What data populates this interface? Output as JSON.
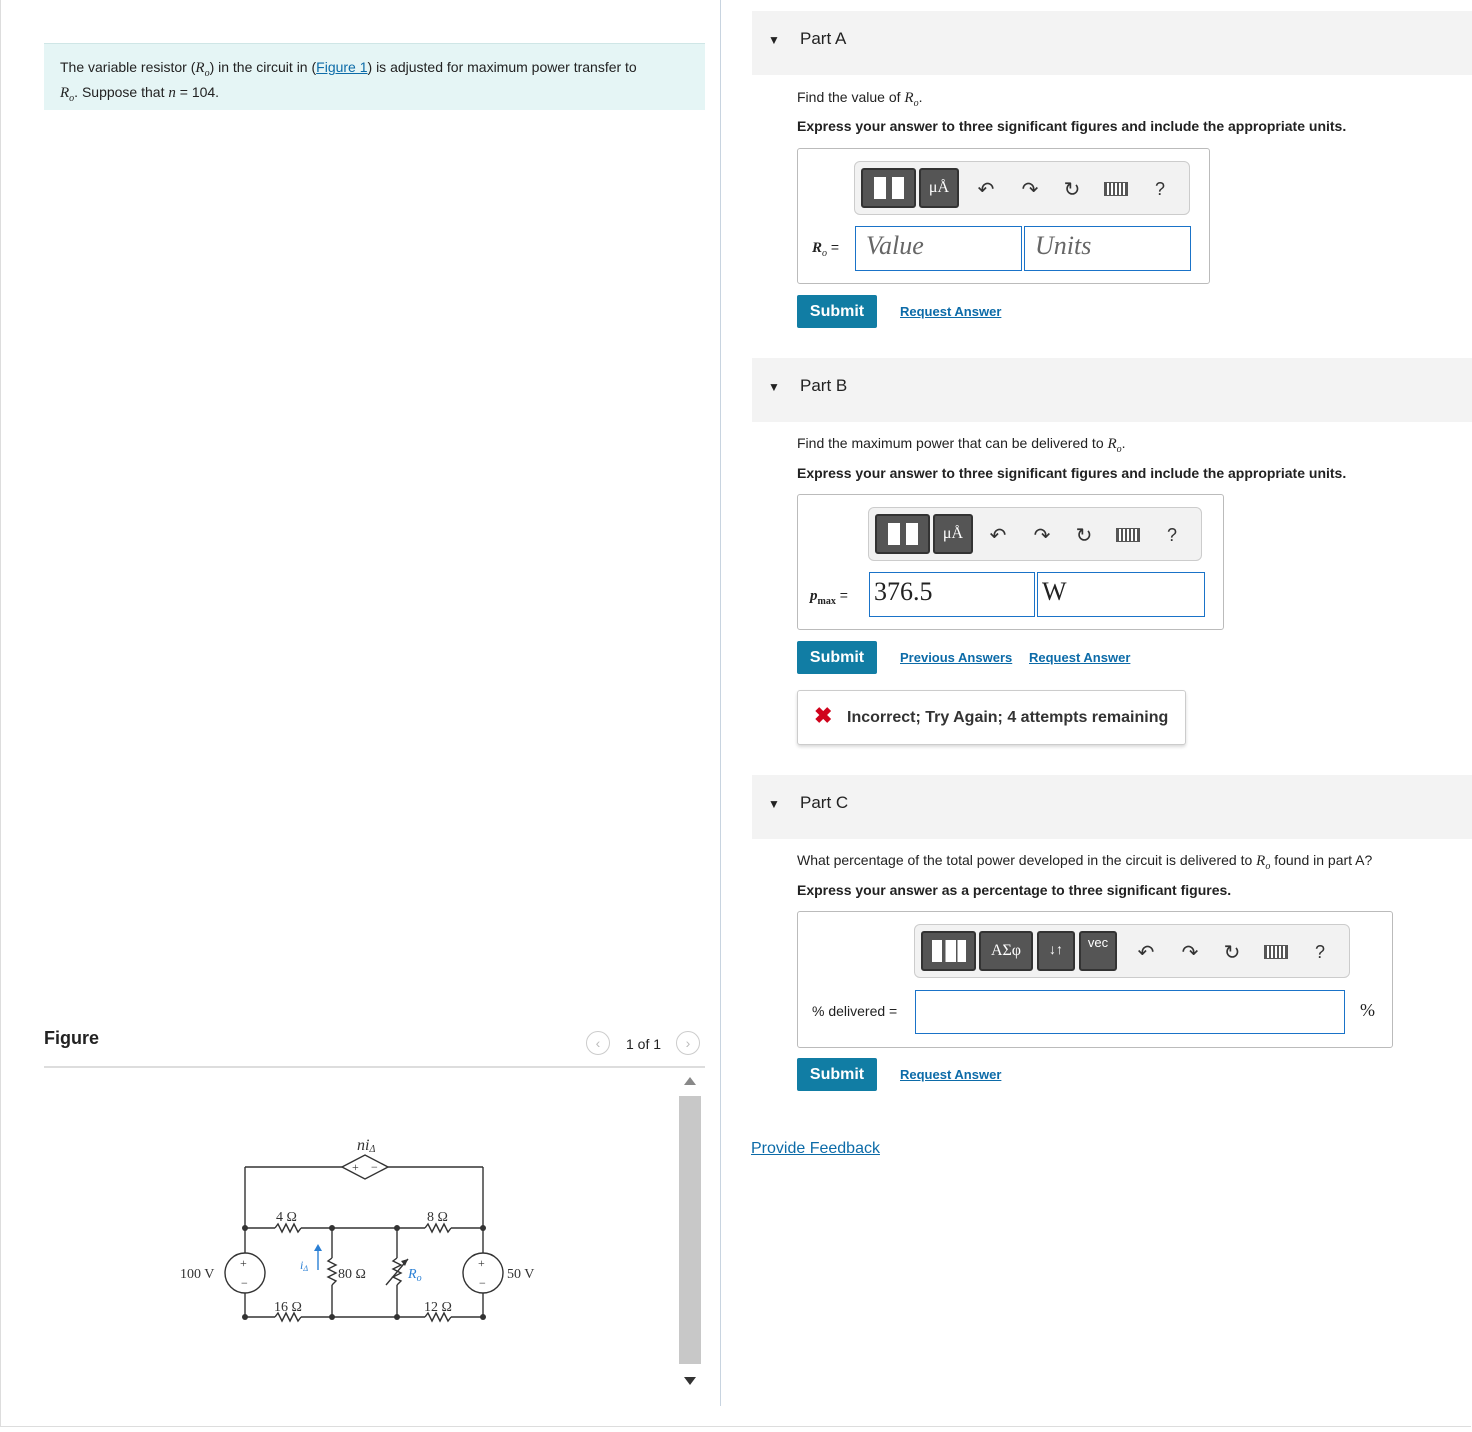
{
  "problem": {
    "text_before_link": "The variable resistor (",
    "r_symbol": "R",
    "r_sub": "o",
    "text_mid": ") in the circuit in (",
    "figure_link": "Figure 1",
    "text_after_link": ") is adjusted for maximum power transfer to",
    "line2_r": "R",
    "line2_r_sub": "o",
    "line2_text": ". Suppose that ",
    "n_symbol": "n",
    "n_value": " = 104."
  },
  "figure": {
    "title": "Figure",
    "pager": "1 of 1",
    "prev_icon": "‹",
    "next_icon": "›",
    "circuit": {
      "dep_source_label": "ni",
      "dep_source_sub": "Δ",
      "dep_plus": "+",
      "dep_minus": "−",
      "r4": "4 Ω",
      "r8": "8 Ω",
      "r80": "80 Ω",
      "ro": "R",
      "ro_sub": "o",
      "r16": "16 Ω",
      "r12": "12 Ω",
      "v100": "100 V",
      "v50": "50 V",
      "i_delta": "i",
      "i_delta_sub": "Δ"
    }
  },
  "partA": {
    "label": "Part A",
    "question": "Find the value of ",
    "question_sym": "R",
    "question_sub": "o",
    "instruction": "Express your answer to three significant figures and include the appropriate units.",
    "var_label": "R",
    "var_sub": "o",
    "eq": " =",
    "value_placeholder": "Value",
    "units_placeholder": "Units",
    "submit": "Submit",
    "request": "Request Answer"
  },
  "partB": {
    "label": "Part B",
    "question": "Find the maximum power that can be delivered to ",
    "question_sym": "R",
    "question_sub": "o",
    "instruction": "Express your answer to three significant figures and include the appropriate units.",
    "var_label": "p",
    "var_sub": "max",
    "eq": " =",
    "value": "376.5",
    "units": "W",
    "submit": "Submit",
    "previous": "Previous Answers",
    "request": "Request Answer",
    "feedback": "Incorrect; Try Again; 4 attempts remaining"
  },
  "partC": {
    "label": "Part C",
    "question_before": "What percentage of the total power developed in the circuit is delivered to ",
    "question_sym": "R",
    "question_sub": "o",
    "question_after": " found in part A?",
    "instruction": "Express your answer as a percentage to three significant figures.",
    "var_label": "% delivered =",
    "unit": "%",
    "submit": "Submit",
    "request": "Request Answer",
    "tool_greek": "ΑΣφ",
    "tool_vec": "vec",
    "tool_arrows": "↓↑"
  },
  "toolbar": {
    "units_btn": "μÅ",
    "help": "?"
  },
  "provide_feedback": "Provide Feedback"
}
